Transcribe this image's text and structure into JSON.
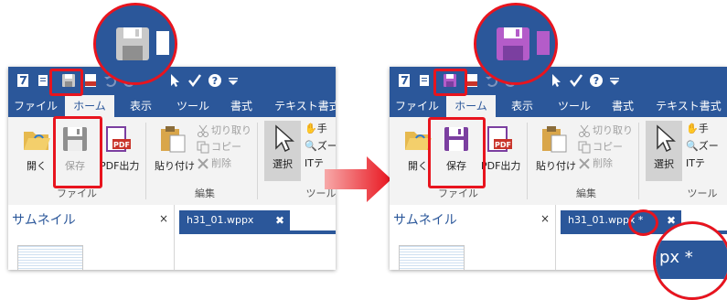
{
  "colors": {
    "ribbon_blue": "#2b579a",
    "highlight_red": "#e8141e",
    "save_icon_normal": "#8f8f8f",
    "save_icon_modified": "#7b3fa0",
    "pdf_red": "#c9342a"
  },
  "left": {
    "tabs": [
      "ファイル",
      "ホーム",
      "表示",
      "ツール",
      "書式",
      "テキスト書式"
    ],
    "buttons": {
      "open": "開く",
      "save": "保存",
      "pdf": "PDF出力",
      "paste": "貼り付け",
      "select": "選択"
    },
    "small_buttons": {
      "cut": "切り取り",
      "copy": "コピー",
      "delete": "削除",
      "hand": "手",
      "zoom": "ズー",
      "text": "テ"
    },
    "groups": {
      "file": "ファイル",
      "edit": "編集",
      "tool": "ツール"
    },
    "pane": {
      "title": "サムネイル",
      "close": "×"
    },
    "doc_tab": {
      "name": "h31_01.wppx",
      "close": "✖"
    }
  },
  "right": {
    "tabs": [
      "ファイル",
      "ホーム",
      "表示",
      "ツール",
      "書式",
      "テキスト書式"
    ],
    "buttons": {
      "open": "開く",
      "save": "保存",
      "pdf": "PDF出力",
      "paste": "貼り付け",
      "select": "選択"
    },
    "small_buttons": {
      "cut": "切り取り",
      "copy": "コピー",
      "delete": "削除",
      "hand": "手",
      "zoom": "ズー",
      "text": "テ"
    },
    "groups": {
      "file": "ファイル",
      "edit": "編集",
      "tool": "ツール"
    },
    "pane": {
      "title": "サムネイル",
      "close": "×"
    },
    "doc_tab": {
      "name": "h31_01.wppx *",
      "close": "✖"
    },
    "zoom_text": "px *"
  }
}
